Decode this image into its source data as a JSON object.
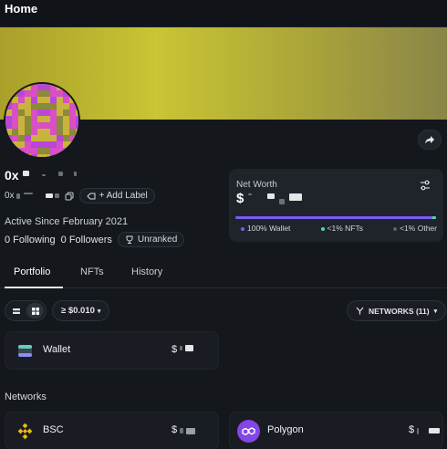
{
  "header": {
    "title": "Home"
  },
  "profile": {
    "address_prefix": "0x",
    "address_short_prefix": "0x",
    "add_label": "+ Add Label",
    "active_since": "Active Since February 2021",
    "following": "0 Following",
    "followers": "0 Followers",
    "rank": "Unranked"
  },
  "net_worth": {
    "label": "Net Worth",
    "currency": "$",
    "wallet_pct": "100% Wallet",
    "nfts_pct": "<1% NFTs",
    "other_pct": "<1% Other",
    "colors": {
      "wallet": "#7a5cf0",
      "nfts": "#4fd6b7",
      "other": "#5b616b"
    }
  },
  "tabs": [
    "Portfolio",
    "NFTs",
    "History"
  ],
  "toolbar": {
    "threshold": "≥ $0.010",
    "networks": "NETWORKS (11)"
  },
  "wallet_card": {
    "name": "Wallet",
    "currency": "$"
  },
  "networks_label": "Networks",
  "networks": [
    {
      "name": "BSC",
      "currency": "$",
      "icon": "bsc-icon",
      "color": "#f0b90b"
    },
    {
      "name": "Polygon",
      "currency": "$",
      "icon": "polygon-icon",
      "color": "#8247e5"
    }
  ],
  "icons": [
    "share-icon",
    "copy-icon",
    "tag-icon",
    "trophy-icon",
    "sliders-icon",
    "list-view-icon",
    "grid-view-icon",
    "network-filter-icon",
    "wallet-icon"
  ]
}
